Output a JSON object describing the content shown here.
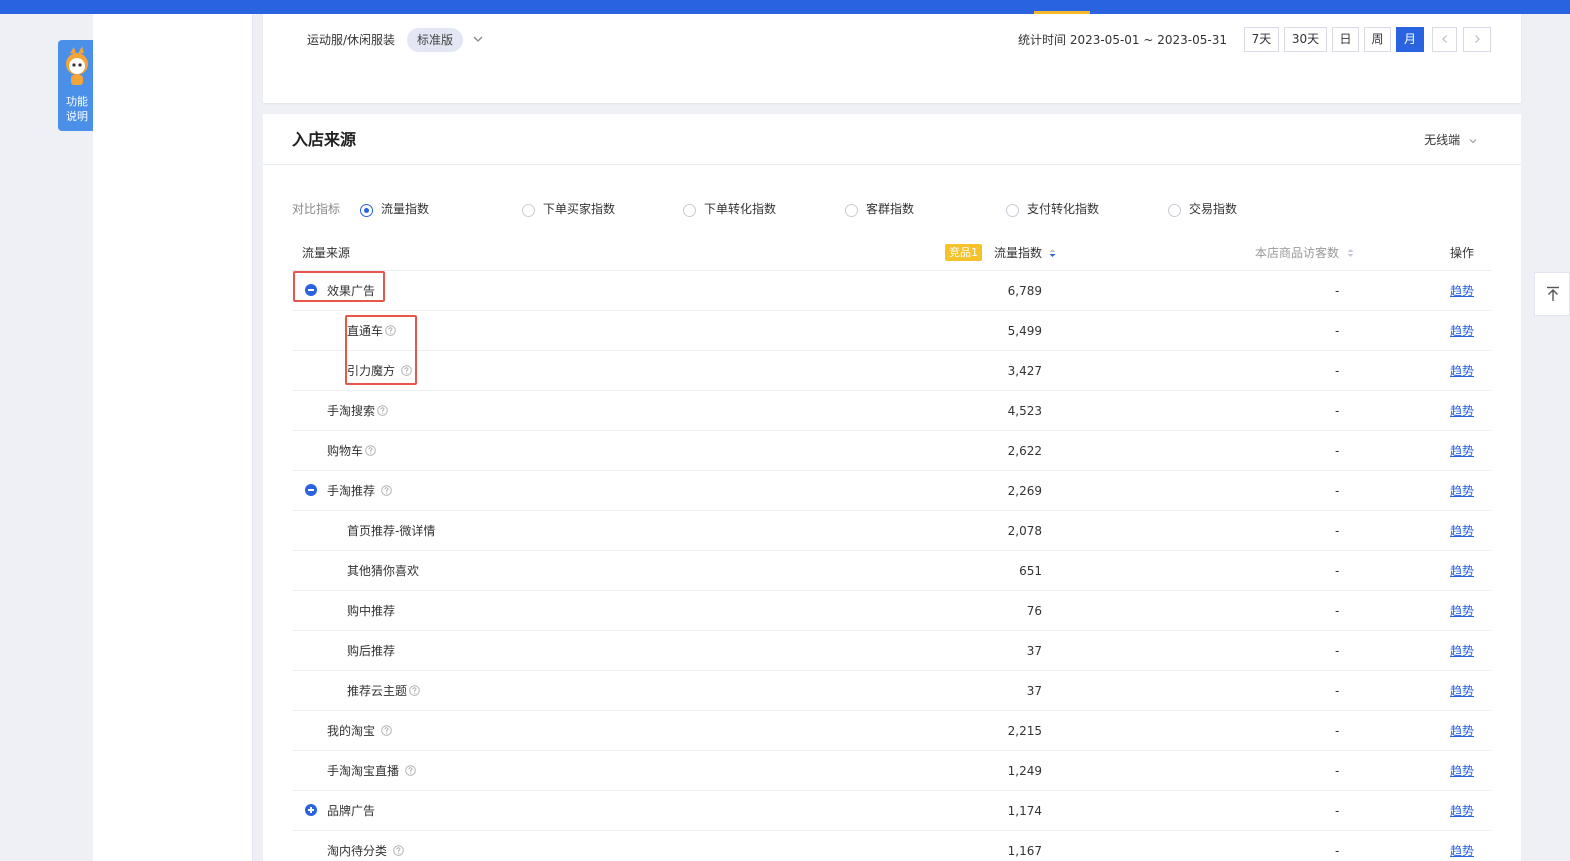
{
  "helper": {
    "label_line1": "功能",
    "label_line2": "说明"
  },
  "header": {
    "category": "运动服/休闲服装",
    "edition": "标准版",
    "date_range": "统计时间 2023-05-01 ~ 2023-05-31",
    "periods": [
      "7天",
      "30天",
      "日",
      "周",
      "月"
    ],
    "active_period": "月"
  },
  "section": {
    "title": "入店来源",
    "terminal": "无线端"
  },
  "metrics": {
    "label": "对比指标",
    "options": [
      "流量指数",
      "下单买家指数",
      "下单转化指数",
      "客群指数",
      "支付转化指数",
      "交易指数"
    ],
    "selected": "流量指数"
  },
  "table": {
    "headers": {
      "source": "流量来源",
      "compare_badge": "竞品1",
      "traffic": "流量指数",
      "visitors": "本店商品访客数",
      "action": "操作"
    },
    "rows": [
      {
        "name": "效果广告",
        "value": "6,789",
        "visitors": "-",
        "action": "趋势"
      },
      {
        "name": "直通车",
        "value": "5,499",
        "visitors": "-",
        "action": "趋势"
      },
      {
        "name": "引力魔方",
        "value": "3,427",
        "visitors": "-",
        "action": "趋势"
      },
      {
        "name": "手淘搜索",
        "value": "4,523",
        "visitors": "-",
        "action": "趋势"
      },
      {
        "name": "购物车",
        "value": "2,622",
        "visitors": "-",
        "action": "趋势"
      },
      {
        "name": "手淘推荐",
        "value": "2,269",
        "visitors": "-",
        "action": "趋势"
      },
      {
        "name": "首页推荐-微详情",
        "value": "2,078",
        "visitors": "-",
        "action": "趋势"
      },
      {
        "name": "其他猜你喜欢",
        "value": "651",
        "visitors": "-",
        "action": "趋势"
      },
      {
        "name": "购中推荐",
        "value": "76",
        "visitors": "-",
        "action": "趋势"
      },
      {
        "name": "购后推荐",
        "value": "37",
        "visitors": "-",
        "action": "趋势"
      },
      {
        "name": "推荐云主题",
        "value": "37",
        "visitors": "-",
        "action": "趋势"
      },
      {
        "name": "我的淘宝",
        "value": "2,215",
        "visitors": "-",
        "action": "趋势"
      },
      {
        "name": "手淘淘宝直播",
        "value": "1,249",
        "visitors": "-",
        "action": "趋势"
      },
      {
        "name": "品牌广告",
        "value": "1,174",
        "visitors": "-",
        "action": "趋势"
      },
      {
        "name": "淘内待分类",
        "value": "1,167",
        "visitors": "-",
        "action": "趋势"
      }
    ]
  }
}
